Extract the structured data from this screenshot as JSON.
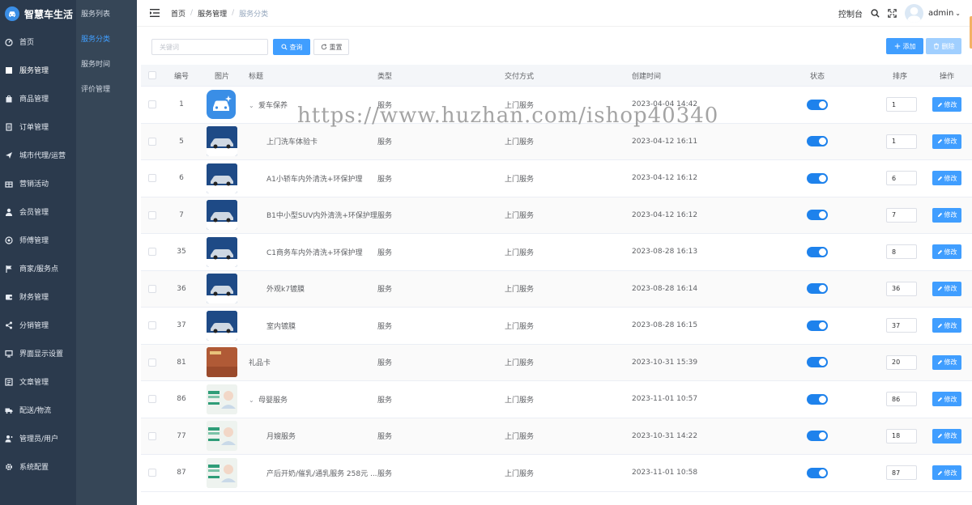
{
  "brand": {
    "title": "智慧车生活"
  },
  "sidebar": {
    "items": [
      {
        "label": "首页",
        "icon": "dashboard-icon"
      },
      {
        "label": "服务管理",
        "icon": "box-icon",
        "active": true
      },
      {
        "label": "商品管理",
        "icon": "shopping-bag-icon"
      },
      {
        "label": "订单管理",
        "icon": "document-icon"
      },
      {
        "label": "城市代理/运营",
        "icon": "paper-plane-icon"
      },
      {
        "label": "营销活动",
        "icon": "gift-icon"
      },
      {
        "label": "会员管理",
        "icon": "user-icon"
      },
      {
        "label": "师傅管理",
        "icon": "badge-icon"
      },
      {
        "label": "商家/服务点",
        "icon": "flag-icon"
      },
      {
        "label": "财务管理",
        "icon": "wallet-icon"
      },
      {
        "label": "分销管理",
        "icon": "share-icon"
      },
      {
        "label": "界面显示设置",
        "icon": "monitor-icon"
      },
      {
        "label": "文章管理",
        "icon": "article-icon"
      },
      {
        "label": "配送/物流",
        "icon": "truck-icon"
      },
      {
        "label": "管理员/用户",
        "icon": "admin-user-icon"
      },
      {
        "label": "系统配置",
        "icon": "gear-icon"
      }
    ]
  },
  "submenu": {
    "items": [
      {
        "label": "服务列表"
      },
      {
        "label": "服务分类",
        "active": true
      },
      {
        "label": "服务时间"
      },
      {
        "label": "评价管理"
      }
    ]
  },
  "header": {
    "breadcrumb": [
      "首页",
      "服务管理",
      "服务分类"
    ],
    "console_label": "控制台",
    "user_name": "admin"
  },
  "toolbar": {
    "search_placeholder": "关键词",
    "query_label": "查询",
    "reset_label": "重置",
    "add_label": "添加",
    "delete_label": "删除"
  },
  "table": {
    "columns": [
      "编号",
      "图片",
      "标题",
      "类型",
      "交付方式",
      "创建时间",
      "状态",
      "排序",
      "操作"
    ],
    "edit_label": "修改",
    "rows": [
      {
        "id": "1",
        "thumb": "app",
        "title": "爱车保养",
        "level": 0,
        "expandable": true,
        "type": "服务",
        "delivery": "上门服务",
        "created": "2023-04-04 14:42",
        "status": true,
        "sort": "1"
      },
      {
        "id": "5",
        "thumb": "car",
        "title": "上门洗车体验卡",
        "level": 1,
        "expandable": false,
        "type": "服务",
        "delivery": "上门服务",
        "created": "2023-04-12 16:11",
        "status": true,
        "sort": "1"
      },
      {
        "id": "6",
        "thumb": "car",
        "title": "A1小轿车内外清洗+环保护理",
        "level": 1,
        "expandable": false,
        "type": "服务",
        "delivery": "上门服务",
        "created": "2023-04-12 16:12",
        "status": true,
        "sort": "6"
      },
      {
        "id": "7",
        "thumb": "car",
        "title": "B1中小型SUV内外清洗+环保护理",
        "level": 1,
        "expandable": false,
        "type": "服务",
        "delivery": "上门服务",
        "created": "2023-04-12 16:12",
        "status": true,
        "sort": "7"
      },
      {
        "id": "35",
        "thumb": "car",
        "title": "C1商务车内外清洗+环保护理",
        "level": 1,
        "expandable": false,
        "type": "服务",
        "delivery": "上门服务",
        "created": "2023-08-28 16:13",
        "status": true,
        "sort": "8"
      },
      {
        "id": "36",
        "thumb": "car",
        "title": "外观k7镀膜",
        "level": 1,
        "expandable": false,
        "type": "服务",
        "delivery": "上门服务",
        "created": "2023-08-28 16:14",
        "status": true,
        "sort": "36"
      },
      {
        "id": "37",
        "thumb": "car",
        "title": "室内镀膜",
        "level": 1,
        "expandable": false,
        "type": "服务",
        "delivery": "上门服务",
        "created": "2023-08-28 16:15",
        "status": true,
        "sort": "37"
      },
      {
        "id": "81",
        "thumb": "gift",
        "title": "礼品卡",
        "level": 0,
        "expandable": false,
        "type": "服务",
        "delivery": "上门服务",
        "created": "2023-10-31 15:39",
        "status": true,
        "sort": "20"
      },
      {
        "id": "86",
        "thumb": "mom",
        "title": "母婴服务",
        "level": 0,
        "expandable": true,
        "type": "服务",
        "delivery": "上门服务",
        "created": "2023-11-01 10:57",
        "status": true,
        "sort": "86"
      },
      {
        "id": "77",
        "thumb": "mom",
        "title": "月嫂服务",
        "level": 1,
        "expandable": false,
        "type": "服务",
        "delivery": "上门服务",
        "created": "2023-10-31 14:22",
        "status": true,
        "sort": "18"
      },
      {
        "id": "87",
        "thumb": "mom",
        "title": "产后开奶/催乳/通乳服务 258元 ...",
        "level": 1,
        "expandable": false,
        "type": "服务",
        "delivery": "上门服务",
        "created": "2023-11-01 10:58",
        "status": true,
        "sort": "87"
      }
    ]
  },
  "watermark": "https://www.huzhan.com/ishop40340",
  "colors": {
    "primary": "#409eff",
    "sidebar_bg": "#2b3a4d",
    "submenu_bg": "#364657",
    "switch_on": "#1e82ec"
  }
}
